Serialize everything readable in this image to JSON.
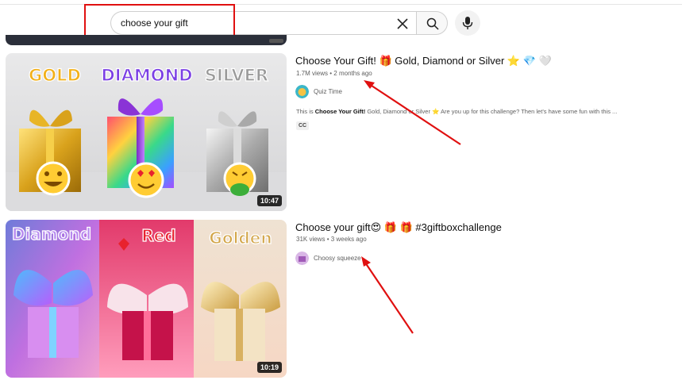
{
  "search": {
    "query": "choose your gift"
  },
  "results": [
    {
      "title": "Choose Your Gift! 🎁 Gold, Diamond or Silver ⭐ 💎 🤍",
      "views": "1.7M views",
      "age": "2 months ago",
      "channel": "Quiz Time",
      "description_bold": "Choose Your Gift!",
      "description_pre": "This is ",
      "description_rest": " Gold, Diamond or Silver ⭐ Are you up for this challenge? Then let's have some fun with this ...",
      "badge": "CC",
      "duration": "10:47",
      "thumb_labels": [
        "GOLD",
        "DIAMOND",
        "SILVER"
      ]
    },
    {
      "title": "Choose your gift😍 🎁 🎁 #3giftboxchallenge",
      "views": "31K views",
      "age": "3 weeks ago",
      "channel": "Choosy squeeze",
      "duration": "10:19",
      "thumb_labels": [
        "Diamond",
        "Red",
        "Golden"
      ]
    }
  ],
  "colors": {
    "annotation": "#e01010",
    "gold": "#e3b22b",
    "silver": "#b9b9b9"
  }
}
